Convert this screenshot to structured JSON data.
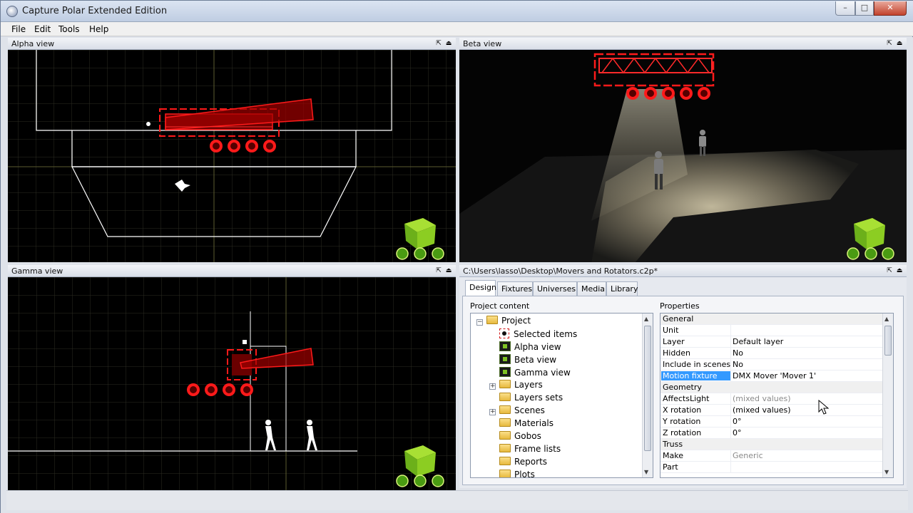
{
  "window": {
    "title": "Capture Polar Extended Edition",
    "controls": {
      "minimize": "–",
      "maximize": "□",
      "close": "✕"
    }
  },
  "menu": {
    "items": [
      "File",
      "Edit",
      "Tools",
      "Help"
    ]
  },
  "panels": {
    "alpha": {
      "title": "Alpha view",
      "pin": "⇱",
      "menu": "⏏"
    },
    "beta": {
      "title": "Beta view",
      "pin": "⇱",
      "menu": "⏏"
    },
    "gamma": {
      "title": "Gamma view",
      "pin": "⇱",
      "menu": "⏏"
    },
    "project": {
      "title": "C:\\Users\\lasso\\Desktop\\Movers and Rotators.c2p*",
      "pin": "⇱",
      "menu": "⏏"
    }
  },
  "tabs": [
    "Design",
    "Fixtures",
    "Universes",
    "Media",
    "Library"
  ],
  "active_tab": "Design",
  "project_content": {
    "label": "Project content",
    "root": "Project",
    "items": [
      {
        "label": "Selected items",
        "icon": "selection-icon",
        "expandable": false,
        "selected": true
      },
      {
        "label": "Alpha view",
        "icon": "view-icon",
        "expandable": false
      },
      {
        "label": "Beta view",
        "icon": "view-icon",
        "expandable": false
      },
      {
        "label": "Gamma view",
        "icon": "view-icon",
        "expandable": false
      },
      {
        "label": "Layers",
        "icon": "folder-icon",
        "expandable": true
      },
      {
        "label": "Layers sets",
        "icon": "folder-icon",
        "expandable": false
      },
      {
        "label": "Scenes",
        "icon": "folder-icon",
        "expandable": true
      },
      {
        "label": "Materials",
        "icon": "folder-icon",
        "expandable": false
      },
      {
        "label": "Gobos",
        "icon": "folder-icon",
        "expandable": false
      },
      {
        "label": "Frame lists",
        "icon": "folder-icon",
        "expandable": false
      },
      {
        "label": "Reports",
        "icon": "folder-icon",
        "expandable": false
      },
      {
        "label": "Plots",
        "icon": "folder-icon",
        "expandable": false
      }
    ]
  },
  "properties": {
    "label": "Properties",
    "rows": [
      {
        "name": "General",
        "value": "",
        "category": true
      },
      {
        "name": "Unit",
        "value": ""
      },
      {
        "name": "Layer",
        "value": "Default layer"
      },
      {
        "name": "Hidden",
        "value": "No"
      },
      {
        "name": "Include in scenes",
        "value": "No"
      },
      {
        "name": "Motion fixture",
        "value": "DMX Mover 'Mover 1'",
        "highlight": true
      },
      {
        "name": "Geometry",
        "value": "",
        "category": true
      },
      {
        "name": "AffectsLight",
        "value": "(mixed values)",
        "muted": true
      },
      {
        "name": "X rotation",
        "value": "(mixed values)"
      },
      {
        "name": "Y rotation",
        "value": "0°"
      },
      {
        "name": "Z rotation",
        "value": "0°"
      },
      {
        "name": "Truss",
        "value": "",
        "category": true
      },
      {
        "name": "Make",
        "value": "Generic",
        "muted": true
      },
      {
        "name": "Part",
        "value": ""
      }
    ]
  },
  "colors": {
    "selection_red": "#ff1a1a",
    "grid_line": "#3a3a2a",
    "axis_line": "#6b6b3a",
    "nav_green": "#7ec123",
    "highlight_blue": "#3399ff"
  }
}
